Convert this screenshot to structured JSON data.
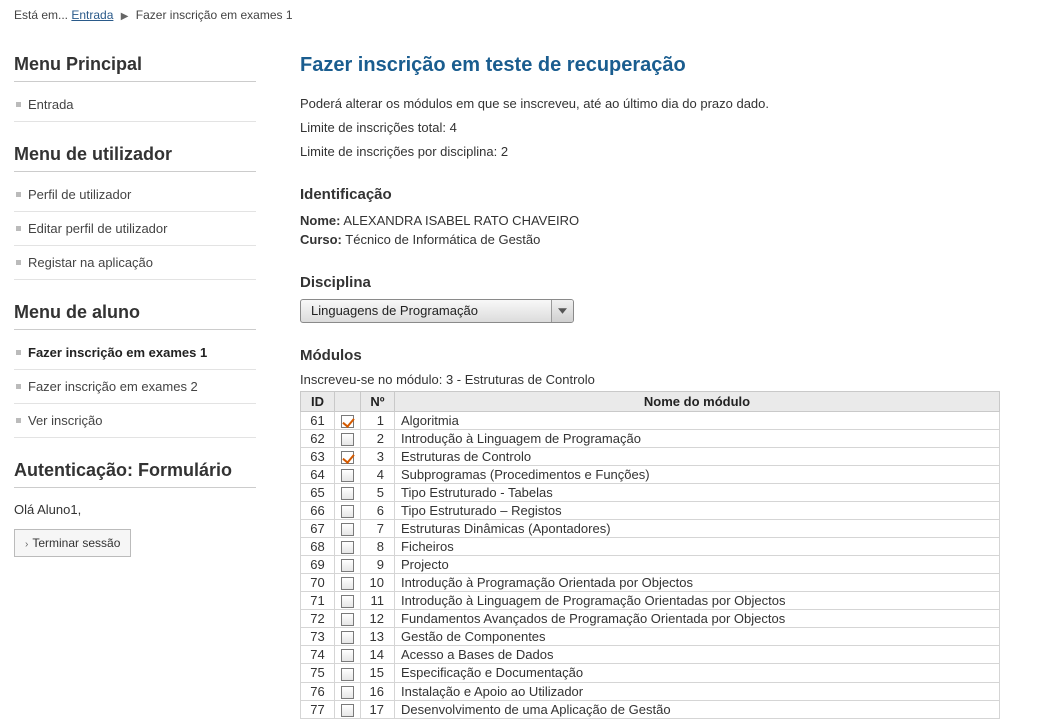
{
  "breadcrumb": {
    "prefix": "Está em...",
    "link": "Entrada",
    "current": "Fazer inscrição em exames 1"
  },
  "sidebar": {
    "menu_principal": {
      "title": "Menu Principal",
      "items": [
        "Entrada"
      ]
    },
    "menu_utilizador": {
      "title": "Menu de utilizador",
      "items": [
        "Perfil de utilizador",
        "Editar perfil de utilizador",
        "Registar na aplicação"
      ]
    },
    "menu_aluno": {
      "title": "Menu de aluno",
      "items": [
        "Fazer inscrição em exames 1",
        "Fazer inscrição em exames 2",
        "Ver inscrição"
      ],
      "active_index": 0
    },
    "auth": {
      "title": "Autenticação: Formulário",
      "greeting": "Olá Aluno1,",
      "logout": "Terminar sessão"
    }
  },
  "page": {
    "title": "Fazer inscrição em teste de recuperação",
    "intro": {
      "line1": "Poderá alterar os módulos em que se inscreveu, até ao último dia do prazo dado.",
      "line2": "Limite de inscrições total: 4",
      "line3": "Limite de inscrições por disciplina: 2"
    },
    "ident": {
      "heading": "Identificação",
      "nome_label": "Nome:",
      "nome_value": "ALEXANDRA ISABEL RATO CHAVEIRO",
      "curso_label": "Curso:",
      "curso_value": "Técnico de Informática de Gestão"
    },
    "disciplina": {
      "heading": "Disciplina",
      "selected": "Linguagens de Programação"
    },
    "modulos": {
      "heading": "Módulos",
      "enrolled_msg": "Inscreveu-se no módulo: 3 - Estruturas de Controlo",
      "headers": {
        "id": "ID",
        "num": "Nº",
        "name": "Nome do módulo"
      },
      "rows": [
        {
          "id": "61",
          "num": "1",
          "name": "Algoritmia",
          "checked": true
        },
        {
          "id": "62",
          "num": "2",
          "name": "Introdução à Linguagem de Programação",
          "checked": false
        },
        {
          "id": "63",
          "num": "3",
          "name": "Estruturas de Controlo",
          "checked": true
        },
        {
          "id": "64",
          "num": "4",
          "name": "Subprogramas (Procedimentos e Funções)",
          "checked": false
        },
        {
          "id": "65",
          "num": "5",
          "name": "Tipo Estruturado - Tabelas",
          "checked": false
        },
        {
          "id": "66",
          "num": "6",
          "name": "Tipo Estruturado – Registos",
          "checked": false
        },
        {
          "id": "67",
          "num": "7",
          "name": "Estruturas Dinâmicas (Apontadores)",
          "checked": false
        },
        {
          "id": "68",
          "num": "8",
          "name": "Ficheiros",
          "checked": false
        },
        {
          "id": "69",
          "num": "9",
          "name": "Projecto",
          "checked": false
        },
        {
          "id": "70",
          "num": "10",
          "name": "Introdução à Programação Orientada por Objectos",
          "checked": false
        },
        {
          "id": "71",
          "num": "11",
          "name": "Introdução à Linguagem de Programação Orientadas por Objectos",
          "checked": false
        },
        {
          "id": "72",
          "num": "12",
          "name": "Fundamentos Avançados de Programação Orientada por Objectos",
          "checked": false
        },
        {
          "id": "73",
          "num": "13",
          "name": "Gestão de Componentes",
          "checked": false
        },
        {
          "id": "74",
          "num": "14",
          "name": "Acesso a Bases de Dados",
          "checked": false
        },
        {
          "id": "75",
          "num": "15",
          "name": "Especificação e Documentação",
          "checked": false
        },
        {
          "id": "76",
          "num": "16",
          "name": "Instalação e Apoio ao Utilizador",
          "checked": false
        },
        {
          "id": "77",
          "num": "17",
          "name": "Desenvolvimento de uma Aplicação de Gestão",
          "checked": false
        }
      ]
    }
  }
}
